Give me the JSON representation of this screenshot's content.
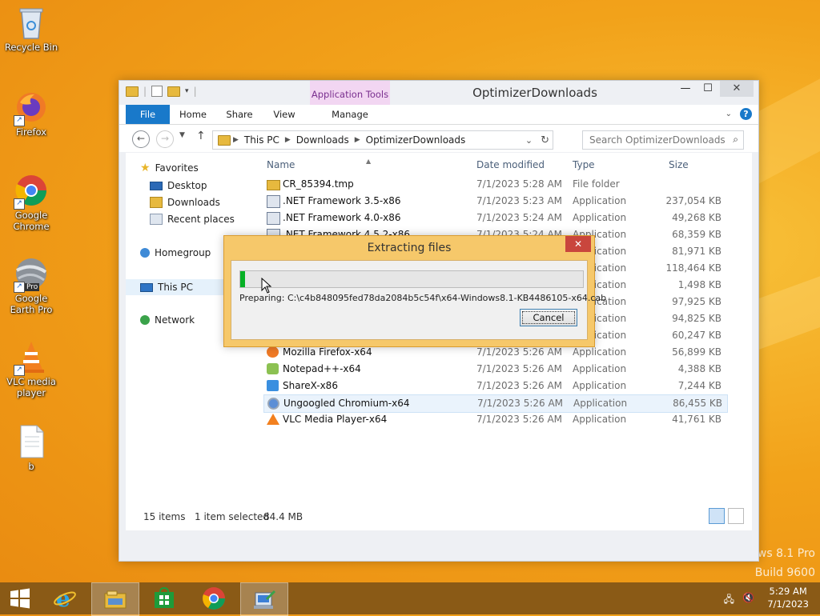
{
  "desktop": {
    "icons": [
      {
        "label": "Recycle Bin",
        "icon": "recycle-bin-icon"
      },
      {
        "label": "Firefox",
        "icon": "firefox-icon"
      },
      {
        "label": "Google Chrome",
        "icon": "chrome-icon"
      },
      {
        "label": "Google Earth Pro",
        "icon": "google-earth-icon",
        "overlay": "Pro"
      },
      {
        "label": "VLC media player",
        "icon": "vlc-icon"
      },
      {
        "label": "b",
        "icon": "text-file-icon"
      }
    ],
    "watermark": {
      "line1": "ows 8.1 Pro",
      "line2": "Build 9600"
    }
  },
  "window": {
    "title": "OptimizerDownloads",
    "context_tab": "Application Tools",
    "tabs": {
      "file": "File",
      "home": "Home",
      "share": "Share",
      "view": "View",
      "manage": "Manage"
    },
    "address": {
      "segments": [
        "This PC",
        "Downloads",
        "OptimizerDownloads"
      ]
    },
    "search_placeholder": "Search OptimizerDownloads",
    "navpane": {
      "favorites": "Favorites",
      "desktop": "Desktop",
      "downloads": "Downloads",
      "recent": "Recent places",
      "homegroup": "Homegroup",
      "thispc": "This PC",
      "network": "Network"
    },
    "columns": {
      "name": "Name",
      "date": "Date modified",
      "type": "Type",
      "size": "Size"
    },
    "files": [
      {
        "name": "CR_85394.tmp",
        "date": "7/1/2023 5:28 AM",
        "type": "File folder",
        "size": "",
        "icon": "folder-icon"
      },
      {
        "name": ".NET Framework 3.5-x86",
        "date": "7/1/2023 5:23 AM",
        "type": "Application",
        "size": "237,054 KB",
        "icon": "installer-icon"
      },
      {
        "name": ".NET Framework 4.0-x86",
        "date": "7/1/2023 5:24 AM",
        "type": "Application",
        "size": "49,268 KB",
        "icon": "installer-icon"
      },
      {
        "name": ".NET Framework 4.5.2-x86",
        "date": "7/1/2023 5:24 AM",
        "type": "Application",
        "size": "68,359 KB",
        "icon": "installer-icon"
      },
      {
        "name": "",
        "date": "",
        "type": "Application",
        "size": "81,971 KB",
        "icon": "installer-icon"
      },
      {
        "name": "",
        "date": "",
        "type": "Application",
        "size": "118,464 KB",
        "icon": "installer-icon"
      },
      {
        "name": "",
        "date": "",
        "type": "Application",
        "size": "1,498 KB",
        "icon": "installer-icon"
      },
      {
        "name": "",
        "date": "",
        "type": "Application",
        "size": "97,925 KB",
        "icon": "installer-icon"
      },
      {
        "name": "",
        "date": "",
        "type": "Application",
        "size": "94,825 KB",
        "icon": "installer-icon"
      },
      {
        "name": "",
        "date": "",
        "type": "Application",
        "size": "60,247 KB",
        "icon": "installer-icon"
      },
      {
        "name": "Mozilla Firefox-x64",
        "date": "7/1/2023 5:26 AM",
        "type": "Application",
        "size": "56,899 KB",
        "icon": "firefox-icon"
      },
      {
        "name": "Notepad++-x64",
        "date": "7/1/2023 5:26 AM",
        "type": "Application",
        "size": "4,388 KB",
        "icon": "notepadpp-icon"
      },
      {
        "name": "ShareX-x86",
        "date": "7/1/2023 5:26 AM",
        "type": "Application",
        "size": "7,244 KB",
        "icon": "sharex-icon"
      },
      {
        "name": "Ungoogled Chromium-x64",
        "date": "7/1/2023 5:26 AM",
        "type": "Application",
        "size": "86,455 KB",
        "icon": "chromium-icon",
        "selected": true
      },
      {
        "name": "VLC Media Player-x64",
        "date": "7/1/2023 5:26 AM",
        "type": "Application",
        "size": "41,761 KB",
        "icon": "vlc-icon"
      }
    ],
    "status": {
      "items": "15 items",
      "selected": "1 item selected",
      "size": "84.4 MB"
    }
  },
  "dialog": {
    "title": "Extracting files",
    "progress": 0.015,
    "text": "Preparing: C:\\c4b848095fed78da2084b5c54f\\x64-Windows8.1-KB4486105-x64.cab",
    "cancel": "Cancel"
  },
  "taskbar": {
    "items": [
      "start-icon",
      "internet-explorer-icon",
      "file-explorer-icon",
      "store-icon",
      "chrome-icon",
      "installer-icon"
    ],
    "time": "5:29 AM",
    "date": "7/1/2023"
  },
  "colors": {
    "accent": "#1979ca",
    "dialog_frame": "#f6c86a",
    "progress": "#06b025",
    "taskbar": "#8a5a16"
  }
}
